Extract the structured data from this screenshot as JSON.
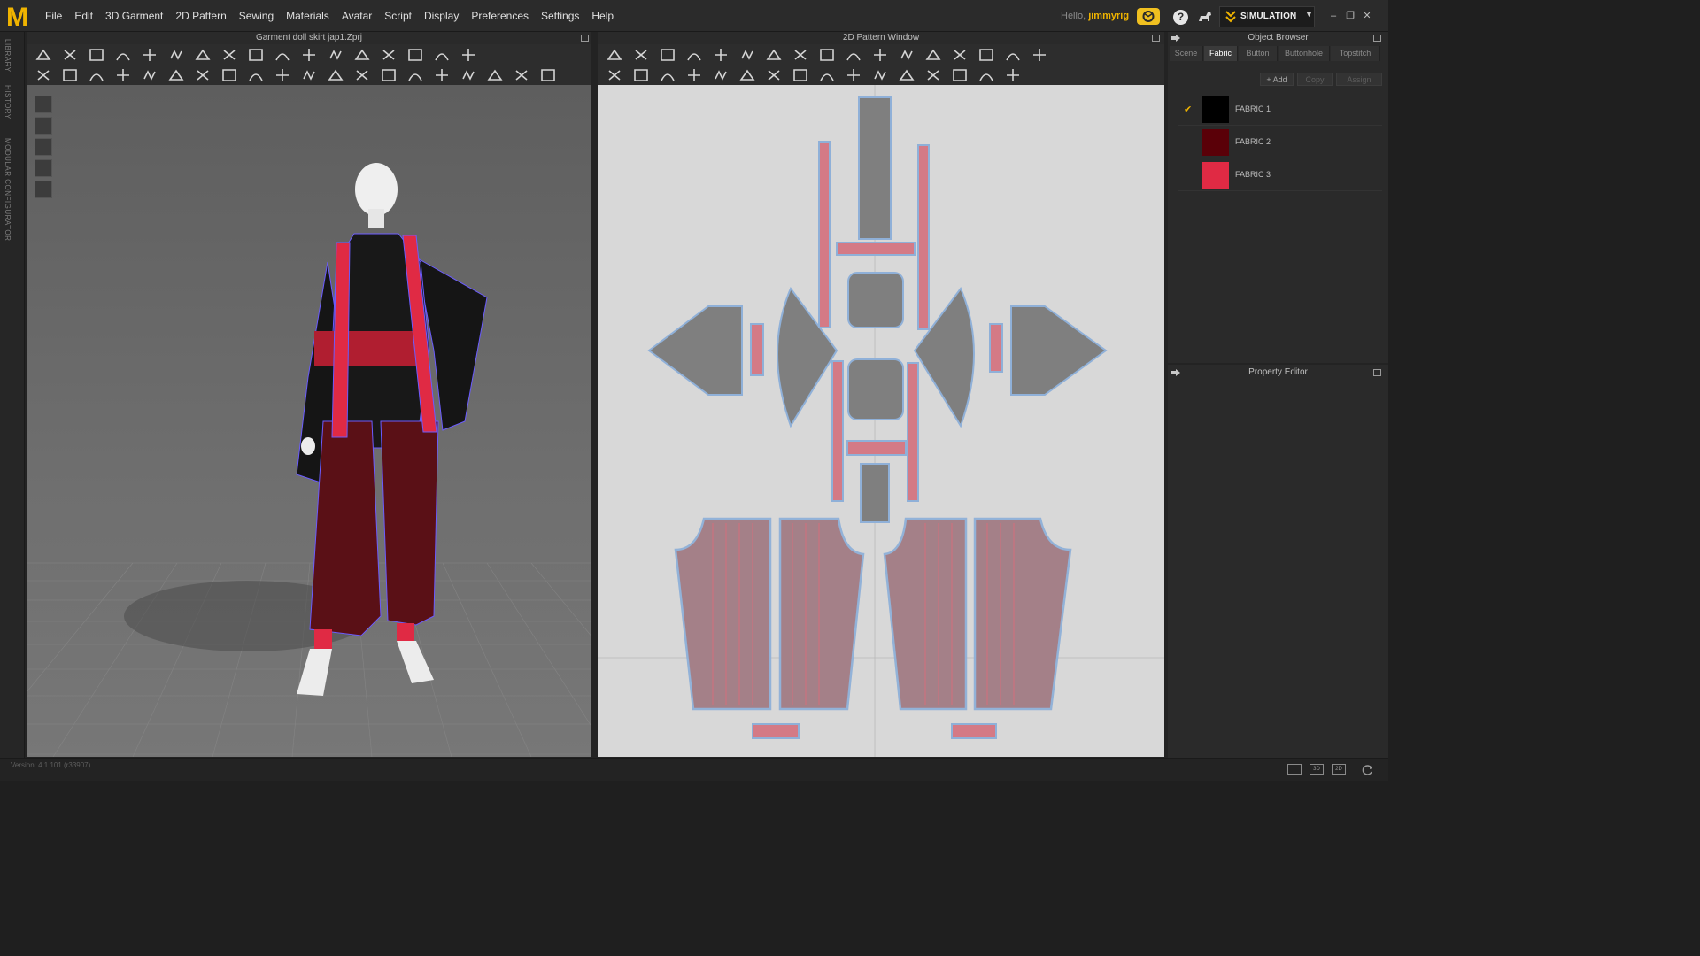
{
  "app": {
    "logo_letter": "M",
    "menus": [
      "File",
      "Edit",
      "3D Garment",
      "2D Pattern",
      "Sewing",
      "Materials",
      "Avatar",
      "Script",
      "Display",
      "Preferences",
      "Settings",
      "Help"
    ],
    "hello_prefix": "Hello,",
    "username": "jimmyrig",
    "mode_label": "SIMULATION",
    "accent_color": "#f0b400"
  },
  "side_tabs": [
    "LIBRARY",
    "HISTORY",
    "MODULAR CONFIGURATOR"
  ],
  "view3d": {
    "title": "Garment doll skirt jap1.Zprj",
    "side_icons": [
      "garment-icon",
      "avatar-icon",
      "fabric-view-icon",
      "texture-icon",
      "skin-icon"
    ]
  },
  "view2d": {
    "title": "2D Pattern Window"
  },
  "object_browser": {
    "title": "Object Browser",
    "tabs": [
      "Scene",
      "Fabric",
      "Button",
      "Buttonhole",
      "Topstitch"
    ],
    "active_tab": "Fabric",
    "buttons": [
      "+ Add",
      "Copy",
      "Assign"
    ],
    "fabrics": [
      {
        "name": "FABRIC 1",
        "color": "#000000",
        "checked": true
      },
      {
        "name": "FABRIC 2",
        "color": "#5a0008",
        "checked": false
      },
      {
        "name": "FABRIC 3",
        "color": "#e02a44",
        "checked": false
      }
    ]
  },
  "property_editor": {
    "title": "Property Editor"
  },
  "status": {
    "version": "Version: 4.1.101 (r33907)",
    "view_modes": [
      "",
      "3D",
      "2D"
    ]
  }
}
